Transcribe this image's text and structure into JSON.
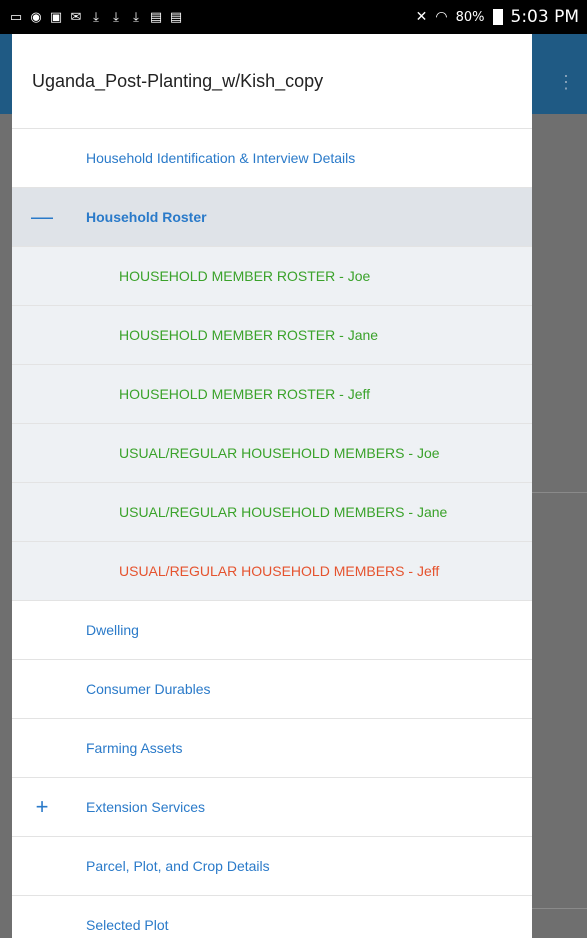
{
  "status_bar": {
    "battery": "80%",
    "time": "5:03 PM",
    "icons": [
      "cast-icon",
      "wifi-hotspot-icon",
      "gallery-icon",
      "mail-icon",
      "download-icon",
      "download-icon",
      "download-icon",
      "clipboard-icon",
      "clipboard-icon"
    ]
  },
  "drawer": {
    "title": "Uganda_Post-Planting_w/Kish_copy",
    "items": [
      {
        "label": "Household Identification & Interview Details",
        "type": "section",
        "lead": ""
      },
      {
        "label": "Household Roster",
        "type": "section-active",
        "lead": "—"
      },
      {
        "label": "HOUSEHOLD MEMBER ROSTER - Joe",
        "type": "sub-done"
      },
      {
        "label": "HOUSEHOLD MEMBER ROSTER - Jane",
        "type": "sub-done"
      },
      {
        "label": "HOUSEHOLD MEMBER ROSTER - Jeff",
        "type": "sub-done"
      },
      {
        "label": "USUAL/REGULAR  HOUSEHOLD MEMBERS - Joe",
        "type": "sub-done"
      },
      {
        "label": "USUAL/REGULAR  HOUSEHOLD MEMBERS - Jane",
        "type": "sub-done"
      },
      {
        "label": "USUAL/REGULAR  HOUSEHOLD MEMBERS - Jeff",
        "type": "sub-error"
      },
      {
        "label": "Dwelling",
        "type": "section",
        "lead": ""
      },
      {
        "label": "Consumer Durables",
        "type": "section",
        "lead": ""
      },
      {
        "label": "Farming Assets",
        "type": "section",
        "lead": ""
      },
      {
        "label": "Extension Services",
        "type": "section",
        "lead": "+"
      },
      {
        "label": "Parcel, Plot, and Crop Details",
        "type": "section",
        "lead": ""
      },
      {
        "label": "Selected Plot",
        "type": "section",
        "lead": ""
      }
    ]
  },
  "colors": {
    "section_text": "#2a7ac9",
    "complete_text": "#3aa22a",
    "error_text": "#e5532e",
    "app_bar": "#1f5a84"
  }
}
